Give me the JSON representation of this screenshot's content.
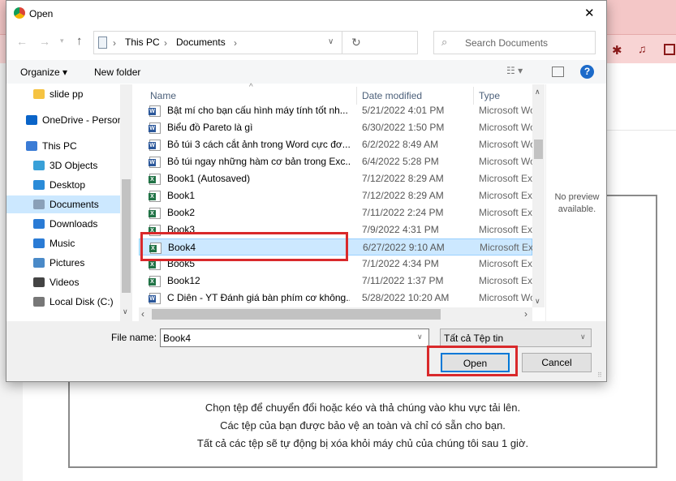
{
  "dialog": {
    "title": "Open",
    "close": "✕"
  },
  "address": {
    "crumbs": [
      "This PC",
      "Documents"
    ],
    "search_placeholder": "Search Documents"
  },
  "toolbar": {
    "organize": "Organize ▾",
    "new_folder": "New folder"
  },
  "nav": [
    {
      "label": "slide pp",
      "icon": "folder-icon",
      "color": "#f5c342"
    },
    {
      "label": "OneDrive - Personal",
      "icon": "cloud-icon",
      "color": "#0a64c8"
    },
    {
      "label": "This PC",
      "icon": "computer-icon",
      "color": "#3a7bd5"
    },
    {
      "label": "3D Objects",
      "icon": "cube-icon",
      "color": "#39a0d8"
    },
    {
      "label": "Desktop",
      "icon": "desktop-icon",
      "color": "#2a8bd8"
    },
    {
      "label": "Documents",
      "icon": "document-icon",
      "color": "#8aa0b8",
      "selected": true
    },
    {
      "label": "Downloads",
      "icon": "download-icon",
      "color": "#2a7bd5"
    },
    {
      "label": "Music",
      "icon": "music-icon",
      "color": "#2a7bd5"
    },
    {
      "label": "Pictures",
      "icon": "pictures-icon",
      "color": "#4a8ac8"
    },
    {
      "label": "Videos",
      "icon": "video-icon",
      "color": "#444"
    },
    {
      "label": "Local Disk (C:)",
      "icon": "disk-icon",
      "color": "#777"
    }
  ],
  "columns": {
    "name": "Name",
    "date": "Date modified",
    "type": "Type"
  },
  "files": [
    {
      "name": "Bật mí cho bạn cấu hình máy tính tốt nh...",
      "date": "5/21/2022 4:01 PM",
      "type": "Microsoft Word Document",
      "kind": "word"
    },
    {
      "name": "Biểu đồ Pareto là gì",
      "date": "6/30/2022 1:50 PM",
      "type": "Microsoft Word Document",
      "kind": "word"
    },
    {
      "name": "Bỏ túi 3 cách cắt ảnh trong Word cực đơ...",
      "date": "6/2/2022 8:49 AM",
      "type": "Microsoft Word Document",
      "kind": "word"
    },
    {
      "name": "Bỏ túi ngay những hàm cơ bản trong Exc...",
      "date": "6/4/2022 5:28 PM",
      "type": "Microsoft Word Document",
      "kind": "word"
    },
    {
      "name": "Book1 (Autosaved)",
      "date": "7/12/2022 8:29 AM",
      "type": "Microsoft Excel Worksheet",
      "kind": "excel"
    },
    {
      "name": "Book1",
      "date": "7/12/2022 8:29 AM",
      "type": "Microsoft Excel Worksheet",
      "kind": "excel"
    },
    {
      "name": "Book2",
      "date": "7/11/2022 2:24 PM",
      "type": "Microsoft Excel Worksheet",
      "kind": "excel"
    },
    {
      "name": "Book3",
      "date": "7/9/2022 4:31 PM",
      "type": "Microsoft Excel Worksheet",
      "kind": "excel"
    },
    {
      "name": "Book4",
      "date": "6/27/2022 9:10 AM",
      "type": "Microsoft Excel Worksheet",
      "kind": "excel",
      "selected": true
    },
    {
      "name": "Book5",
      "date": "7/1/2022 4:34 PM",
      "type": "Microsoft Excel Worksheet",
      "kind": "excel"
    },
    {
      "name": "Book12",
      "date": "7/11/2022 1:37 PM",
      "type": "Microsoft Excel Worksheet",
      "kind": "excel"
    },
    {
      "name": "C Diên - YT Đánh giá bàn phím cơ không...",
      "date": "5/28/2022 10:20 AM",
      "type": "Microsoft Word Document",
      "kind": "word"
    }
  ],
  "preview": "No preview available.",
  "footer": {
    "file_name_label": "File name:",
    "file_name_value": "Book4",
    "filter": "Tất cả Tệp tin",
    "open": "Open",
    "cancel": "Cancel"
  },
  "page": {
    "lines": [
      "Chọn tệp để chuyển đổi hoặc kéo và thả chúng vào khu vực tải lên.",
      "Các tệp của bạn được bảo vệ an toàn và chỉ có sẵn cho bạn.",
      "Tất cả các tệp sẽ tự động bị xóa khỏi máy chủ của chúng tôi sau 1 giờ."
    ]
  },
  "colors": {
    "highlight": "#d9292b",
    "selection": "#cce8ff",
    "word": "#2b579a",
    "excel": "#217346"
  }
}
